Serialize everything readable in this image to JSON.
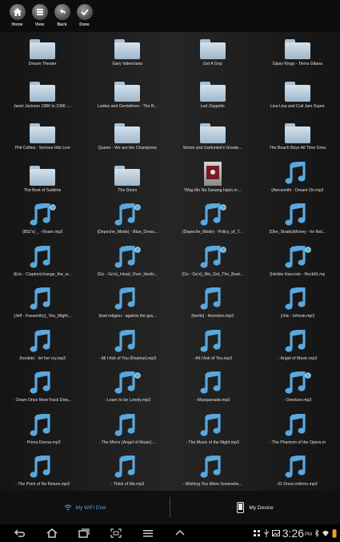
{
  "toolbar": {
    "buttons": [
      {
        "label": "Home",
        "icon": "home-icon"
      },
      {
        "label": "View",
        "icon": "grid-view-icon"
      },
      {
        "label": "Back",
        "icon": "back-icon"
      },
      {
        "label": "Done",
        "icon": "checkmark-icon"
      }
    ]
  },
  "colors": {
    "accent": "#53a9d6",
    "folder": "#c9d9e6",
    "music_note": "#5aa8de"
  },
  "items": [
    {
      "name": "Dream Theater",
      "type": "folder"
    },
    {
      "name": "Gary Valenciano",
      "type": "folder"
    },
    {
      "name": "Get A Grip",
      "type": "folder"
    },
    {
      "name": "Gipsy Kings - Tierra Gitana",
      "type": "folder"
    },
    {
      "name": "Janet Jackson 1986 to 1996 -...",
      "type": "folder"
    },
    {
      "name": "Ladies and Gentelmen - The B...",
      "type": "folder"
    },
    {
      "name": "Led Zeppelin",
      "type": "folder"
    },
    {
      "name": "Lisa Lisa and Cult Jam Super",
      "type": "folder"
    },
    {
      "name": "Phil Collins - Serious Hits Live",
      "type": "folder"
    },
    {
      "name": "Queen - We are the Champions",
      "type": "folder"
    },
    {
      "name": "Simon and Garfunkel's Greate...",
      "type": "folder"
    },
    {
      "name": "The Beach Boys All Time Grea",
      "type": "folder"
    },
    {
      "name": "The Best of Sublime",
      "type": "folder"
    },
    {
      "name": "The Doors",
      "type": "folder"
    },
    {
      "name": "'Wag Mo Na Sanang Isipin.m...",
      "type": "album"
    },
    {
      "name": "(Aerosmith - Dream On.mp3",
      "type": "music"
    },
    {
      "name": "(B52's) _ - Roam.mp3",
      "type": "music-badge"
    },
    {
      "name": "(Depeche_Mode) - Blue_Dress...",
      "type": "music-badge"
    },
    {
      "name": "(Depeche_Mode) - Policy_of_T...",
      "type": "music-badge"
    },
    {
      "name": "(Dire_Straits)Money - for Not...",
      "type": "music"
    },
    {
      "name": "(Eric - Clapton)change_the_w...",
      "type": "music"
    },
    {
      "name": "(Go - Go's)_Head_Over_Heels...",
      "type": "music-badge"
    },
    {
      "name": "(Go - Go's)_We_Got_The_Beat...",
      "type": "music-badge"
    },
    {
      "name": "(Herbie Hancock - Rockit1.mp",
      "type": "music-badge"
    },
    {
      "name": "(Jeff - Foxworthy)_You_Might...",
      "type": "music"
    },
    {
      "name": "(bad religion - againts the gra...",
      "type": "music"
    },
    {
      "name": "(berlin) - themetro.mp3",
      "type": "music"
    },
    {
      "name": "(chic - lefreak.mp3",
      "type": "music"
    },
    {
      "name": "(hoobie) - let her cry.mp3",
      "type": "music"
    },
    {
      "name": "- All I Ask of You (Reprise).mp3",
      "type": "music"
    },
    {
      "name": "- All I Ask of You.mp3",
      "type": "music"
    },
    {
      "name": "- Angel of Music.mp3",
      "type": "music"
    },
    {
      "name": "- Down Once MoreTrack Dow...",
      "type": "music"
    },
    {
      "name": "- Learn to be Lonely.mp3",
      "type": "music-badge"
    },
    {
      "name": "- Masquerade.mp3",
      "type": "music"
    },
    {
      "name": "- Overture.mp3",
      "type": "music-badge"
    },
    {
      "name": "- Prima Donna.mp3",
      "type": "music"
    },
    {
      "name": "- The Mirror (Angel of Music)....",
      "type": "music"
    },
    {
      "name": "- The Music of the Night.mp3",
      "type": "music"
    },
    {
      "name": "- The Phantom of the Opera.m",
      "type": "music"
    },
    {
      "name": "- The Point of No Return.mp3",
      "type": "music"
    },
    {
      "name": "- Think of Me.mp3",
      "type": "music"
    },
    {
      "name": "- Wishing You Were Somewhe...",
      "type": "music"
    },
    {
      "name": "01 Dress inferno.mp3",
      "type": "music"
    }
  ],
  "bottom_tabs": {
    "wifi_label": "My WiFi Disk",
    "device_label": "My Device"
  },
  "status": {
    "time": "3:26",
    "ampm": "PM"
  }
}
